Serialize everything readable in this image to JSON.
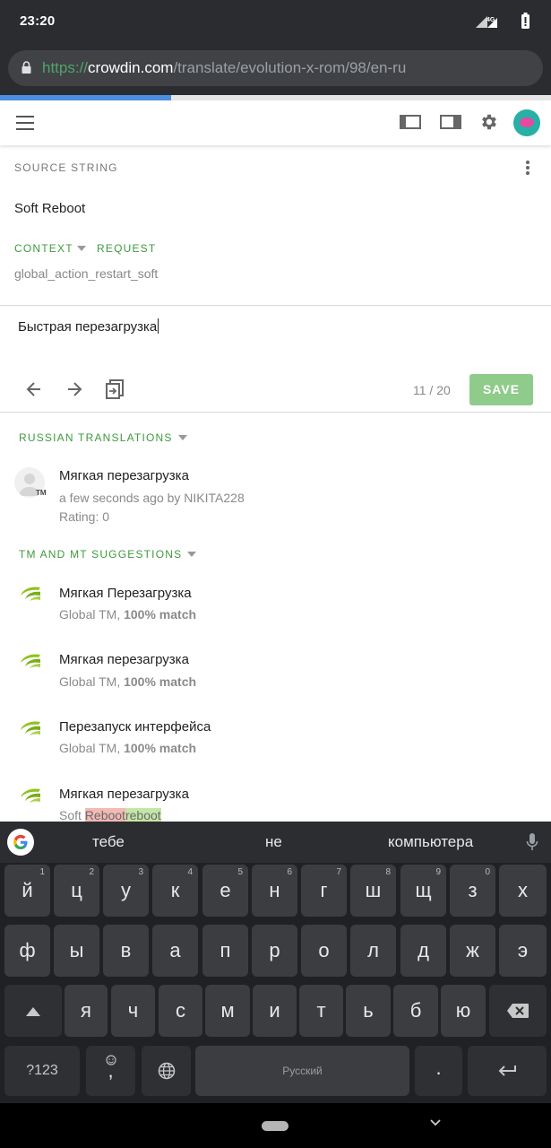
{
  "status": {
    "time": "23:20",
    "network": "4G"
  },
  "browser": {
    "url_scheme": "https://",
    "url_host": "crowdin.com",
    "url_path": "/translate/evolution-x-rom/98/en-ru",
    "progress": 0.31
  },
  "source": {
    "label": "SOURCE STRING",
    "text": "Soft Reboot",
    "context_label": "CONTEXT",
    "request_label": "REQUEST",
    "context_id": "global_action_restart_soft"
  },
  "editor": {
    "value": "Быстрая перезагрузка",
    "counter": "11 / 20",
    "save_label": "SAVE"
  },
  "russian_translations": {
    "label": "RUSSIAN TRANSLATIONS",
    "items": [
      {
        "text": "Мягкая перезагрузка",
        "meta": "a few seconds ago by NIKITA228",
        "rating": "Rating: 0",
        "avatar_badge": "TM"
      }
    ]
  },
  "suggestions": {
    "label": "TM AND MT SUGGESTIONS",
    "items": [
      {
        "text": "Мягкая Перезагрузка",
        "source": "Global TM,",
        "match": "100% match"
      },
      {
        "text": "Мягкая перезагрузка",
        "source": "Global TM,",
        "match": "100% match"
      },
      {
        "text": "Перезапуск интерфейса",
        "source": "Global TM,",
        "match": "100% match"
      },
      {
        "text": "Мягкая перезагрузка",
        "diff_prefix": "Soft ",
        "diff_removed": "Reboot",
        "diff_added": "reboot"
      }
    ]
  },
  "keyboard": {
    "suggestions": [
      "тебе",
      "не",
      "компьютера"
    ],
    "row1": [
      {
        "k": "й",
        "h": "1"
      },
      {
        "k": "ц",
        "h": "2"
      },
      {
        "k": "у",
        "h": "3"
      },
      {
        "k": "к",
        "h": "4"
      },
      {
        "k": "е",
        "h": "5"
      },
      {
        "k": "н",
        "h": "6"
      },
      {
        "k": "г",
        "h": "7"
      },
      {
        "k": "ш",
        "h": "8"
      },
      {
        "k": "щ",
        "h": "9"
      },
      {
        "k": "з",
        "h": "0"
      },
      {
        "k": "х",
        "h": ""
      }
    ],
    "row2": [
      "ф",
      "ы",
      "в",
      "а",
      "п",
      "р",
      "о",
      "л",
      "д",
      "ж",
      "э"
    ],
    "row3": [
      "я",
      "ч",
      "с",
      "м",
      "и",
      "т",
      "ь",
      "б",
      "ю"
    ],
    "symbols_label": "?123",
    "emoji_comma": ",",
    "space_label": "Русский",
    "period": "."
  },
  "colors": {
    "accent_green": "#3f9a3f",
    "save_green": "#8fcb8b",
    "progress_blue": "#4a90e2"
  }
}
